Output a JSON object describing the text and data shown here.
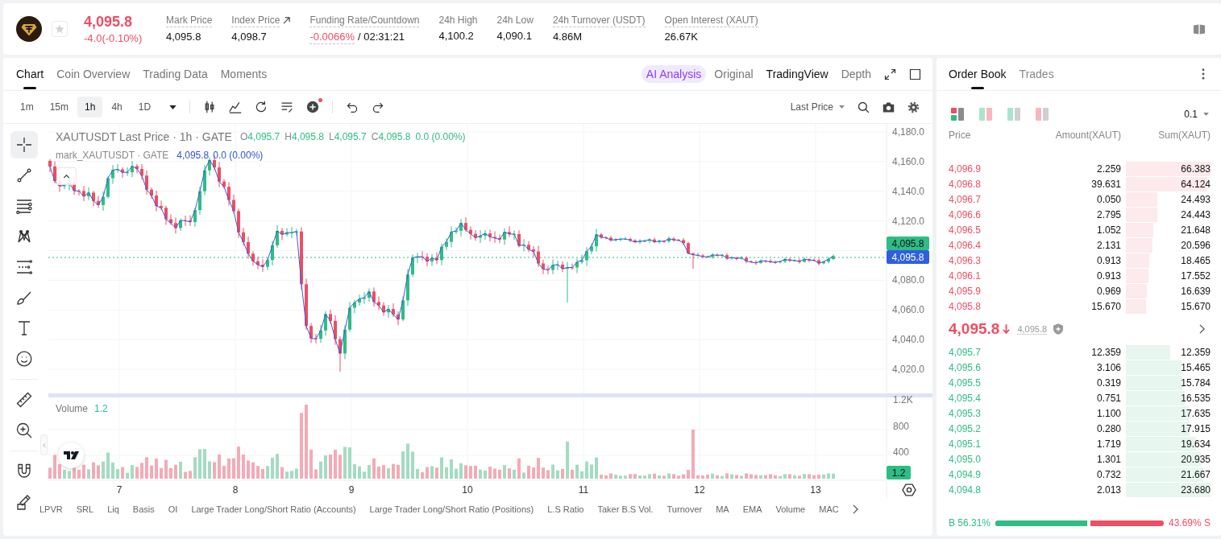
{
  "header": {
    "price": "4,095.8",
    "change": "-4.0(-0.10%)",
    "negative": true,
    "favorite": false,
    "stats": [
      {
        "label": "Mark Price",
        "value": "4,095.8",
        "tooltip": true,
        "link": false,
        "negative": false
      },
      {
        "label": "Index Price",
        "value": "4,098.7",
        "tooltip": true,
        "link": true,
        "negative": false
      },
      {
        "label": "Funding Rate/Countdown",
        "value": "-0.0066%",
        "countdown": "/ 02:31:21",
        "tooltip": true,
        "link": false,
        "negative": true
      },
      {
        "label": "24h High",
        "value": "4,100.2",
        "tooltip": false,
        "link": false,
        "negative": false
      },
      {
        "label": "24h Low",
        "value": "4,090.1",
        "tooltip": false,
        "link": false,
        "negative": false
      },
      {
        "label": "24h Turnover (USDT)",
        "value": "4.86M",
        "tooltip": true,
        "link": false,
        "negative": false
      },
      {
        "label": "Open Interest (XAUT)",
        "value": "26.67K",
        "tooltip": true,
        "link": false,
        "negative": false
      }
    ]
  },
  "chart_panel": {
    "tabs": [
      {
        "label": "Chart",
        "selected": true
      },
      {
        "label": "Coin Overview",
        "selected": false
      },
      {
        "label": "Trading Data",
        "selected": false
      },
      {
        "label": "Moments",
        "selected": false
      }
    ],
    "ai_button": "AI Analysis",
    "views": [
      {
        "label": "Original",
        "selected": false
      },
      {
        "label": "TradingView",
        "selected": true
      },
      {
        "label": "Depth",
        "selected": false
      }
    ],
    "intervals": [
      {
        "label": "1m",
        "selected": false
      },
      {
        "label": "15m",
        "selected": false
      },
      {
        "label": "1h",
        "selected": true
      },
      {
        "label": "4h",
        "selected": false
      },
      {
        "label": "1D",
        "selected": false
      }
    ],
    "tools": [
      {
        "kind": "candles",
        "notify": false
      },
      {
        "kind": "indicators",
        "notify": false
      },
      {
        "kind": "replay",
        "notify": false
      },
      {
        "kind": "templates",
        "notify": false
      },
      {
        "kind": "add",
        "notify": true
      }
    ],
    "price_source": "Last Price",
    "drawing_tool_groups": [
      {
        "tools": [
          {
            "kind": "crosshair",
            "selected": true
          },
          {
            "kind": "trend_line",
            "selected": false
          },
          {
            "kind": "horizontal_lines",
            "selected": false
          },
          {
            "kind": "pattern",
            "selected": false
          },
          {
            "kind": "parallel_lines",
            "selected": false
          },
          {
            "kind": "brush",
            "selected": false
          },
          {
            "kind": "text",
            "selected": false
          },
          {
            "kind": "emoji",
            "selected": false
          }
        ]
      },
      {
        "tools": [
          {
            "kind": "ruler",
            "selected": false
          },
          {
            "kind": "zoom_in",
            "selected": false
          }
        ]
      },
      {
        "tools": [
          {
            "kind": "magnet",
            "selected": false
          },
          {
            "kind": "lock",
            "selected": false
          }
        ]
      }
    ],
    "legend": {
      "title": "XAUTUSDT Last Price · 1h · GATE",
      "ohlc": [
        {
          "key": "O",
          "value": "4,095.7"
        },
        {
          "key": "H",
          "value": "4,095.8"
        },
        {
          "key": "L",
          "value": "4,095.7"
        },
        {
          "key": "C",
          "value": "4,095.8"
        }
      ],
      "change": "0.0 (0.00%)",
      "mark_title": "mark_XAUTUSDT · GATE",
      "mark_value": "4,095.8",
      "mark_change": "0.0 (0.00%)"
    },
    "price_axis": [
      "4,180.0",
      "4,160.0",
      "4,140.0",
      "4,120.0",
      "4,080.0",
      "4,060.0",
      "4,040.0",
      "4,020.0"
    ],
    "last_price_tag": "4,095.8",
    "mark_price_tag": "4,095.8",
    "volume_legend": {
      "label": "Volume",
      "value": "1.2"
    },
    "volume_axis": [
      "1.2K",
      "800",
      "400"
    ],
    "volume_tag": "1.2",
    "time_axis": [
      "7",
      "8",
      "9",
      "10",
      "11",
      "12",
      "13"
    ],
    "indicators": [
      "LPVR",
      "SRL",
      "Liq",
      "Basis",
      "OI",
      "Large Trader Long/Short Ratio (Accounts)",
      "Large Trader Long/Short Ratio (Positions)",
      "L.S Ratio",
      "Taker B.S Vol.",
      "Turnover",
      "MA",
      "EMA",
      "Volume",
      "MAC"
    ]
  },
  "order_book": {
    "tabs": [
      {
        "label": "Order Book",
        "selected": true
      },
      {
        "label": "Trades",
        "selected": false
      }
    ],
    "views": [
      {
        "kind": "both",
        "selected": true
      },
      {
        "kind": "split",
        "selected": false
      },
      {
        "kind": "bids",
        "selected": false
      },
      {
        "kind": "asks",
        "selected": false
      }
    ],
    "precision": "0.1",
    "columns": [
      "Price",
      "Amount(XAUT)",
      "Sum(XAUT)"
    ],
    "asks": [
      {
        "price": "4,096.9",
        "amount": "2.259",
        "sum": "66.383"
      },
      {
        "price": "4,096.8",
        "amount": "39.631",
        "sum": "64.124"
      },
      {
        "price": "4,096.7",
        "amount": "0.050",
        "sum": "24.493"
      },
      {
        "price": "4,096.6",
        "amount": "2.795",
        "sum": "24.443"
      },
      {
        "price": "4,096.5",
        "amount": "1.052",
        "sum": "21.648"
      },
      {
        "price": "4,096.4",
        "amount": "2.131",
        "sum": "20.596"
      },
      {
        "price": "4,096.3",
        "amount": "0.913",
        "sum": "18.465"
      },
      {
        "price": "4,096.1",
        "amount": "0.913",
        "sum": "17.552"
      },
      {
        "price": "4,095.9",
        "amount": "0.969",
        "sum": "16.639"
      },
      {
        "price": "4,095.8",
        "amount": "15.670",
        "sum": "15.670"
      }
    ],
    "last_price": "4,095.8",
    "last_falling": true,
    "mark_price": "4,095.8",
    "bids": [
      {
        "price": "4,095.7",
        "amount": "12.359",
        "sum": "12.359"
      },
      {
        "price": "4,095.6",
        "amount": "3.106",
        "sum": "15.465"
      },
      {
        "price": "4,095.5",
        "amount": "0.319",
        "sum": "15.784"
      },
      {
        "price": "4,095.4",
        "amount": "0.751",
        "sum": "16.535"
      },
      {
        "price": "4,095.3",
        "amount": "1.100",
        "sum": "17.635"
      },
      {
        "price": "4,095.2",
        "amount": "0.280",
        "sum": "17.915"
      },
      {
        "price": "4,095.1",
        "amount": "1.719",
        "sum": "19.634"
      },
      {
        "price": "4,095.0",
        "amount": "1.301",
        "sum": "20.935"
      },
      {
        "price": "4,094.9",
        "amount": "0.732",
        "sum": "21.667"
      },
      {
        "price": "4,094.8",
        "amount": "2.013",
        "sum": "23.680"
      }
    ],
    "ratio": {
      "buy": "B 56.31%",
      "sell": "43.69% S",
      "level": 0.5631
    }
  }
}
